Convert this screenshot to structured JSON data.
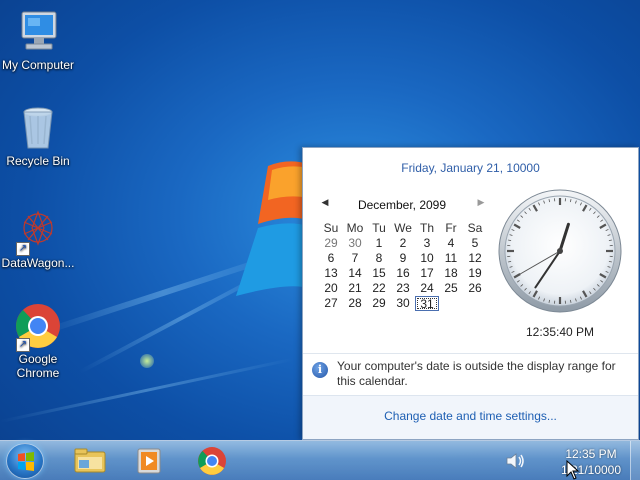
{
  "desktop": {
    "icons": [
      {
        "label": "My Computer"
      },
      {
        "label": "Recycle Bin"
      },
      {
        "label": "DataWagon..."
      },
      {
        "label": "Google Chrome"
      }
    ]
  },
  "flyout": {
    "full_date": "Friday, January 21, 10000",
    "calendar": {
      "month_label": "December, 2099",
      "weekday_headers": [
        "Su",
        "Mo",
        "Tu",
        "We",
        "Th",
        "Fr",
        "Sa"
      ],
      "weeks": [
        [
          "29",
          "30",
          "1",
          "2",
          "3",
          "4",
          "5"
        ],
        [
          "6",
          "7",
          "8",
          "9",
          "10",
          "11",
          "12"
        ],
        [
          "13",
          "14",
          "15",
          "16",
          "17",
          "18",
          "19"
        ],
        [
          "20",
          "21",
          "22",
          "23",
          "24",
          "25",
          "26"
        ],
        [
          "27",
          "28",
          "29",
          "30",
          "31",
          "",
          ""
        ]
      ],
      "selected_day": "31"
    },
    "clock_time": "12:35:40 PM",
    "info_message": "Your computer's date is outside the display range for this calendar.",
    "change_link": "Change date and time settings..."
  },
  "taskbar": {
    "time": "12:35 PM",
    "date": "1/21/10000"
  },
  "colors": {
    "link": "#1e5fb3",
    "date_header": "#2f5ea8",
    "desktop_blue": "#1a68c2"
  }
}
